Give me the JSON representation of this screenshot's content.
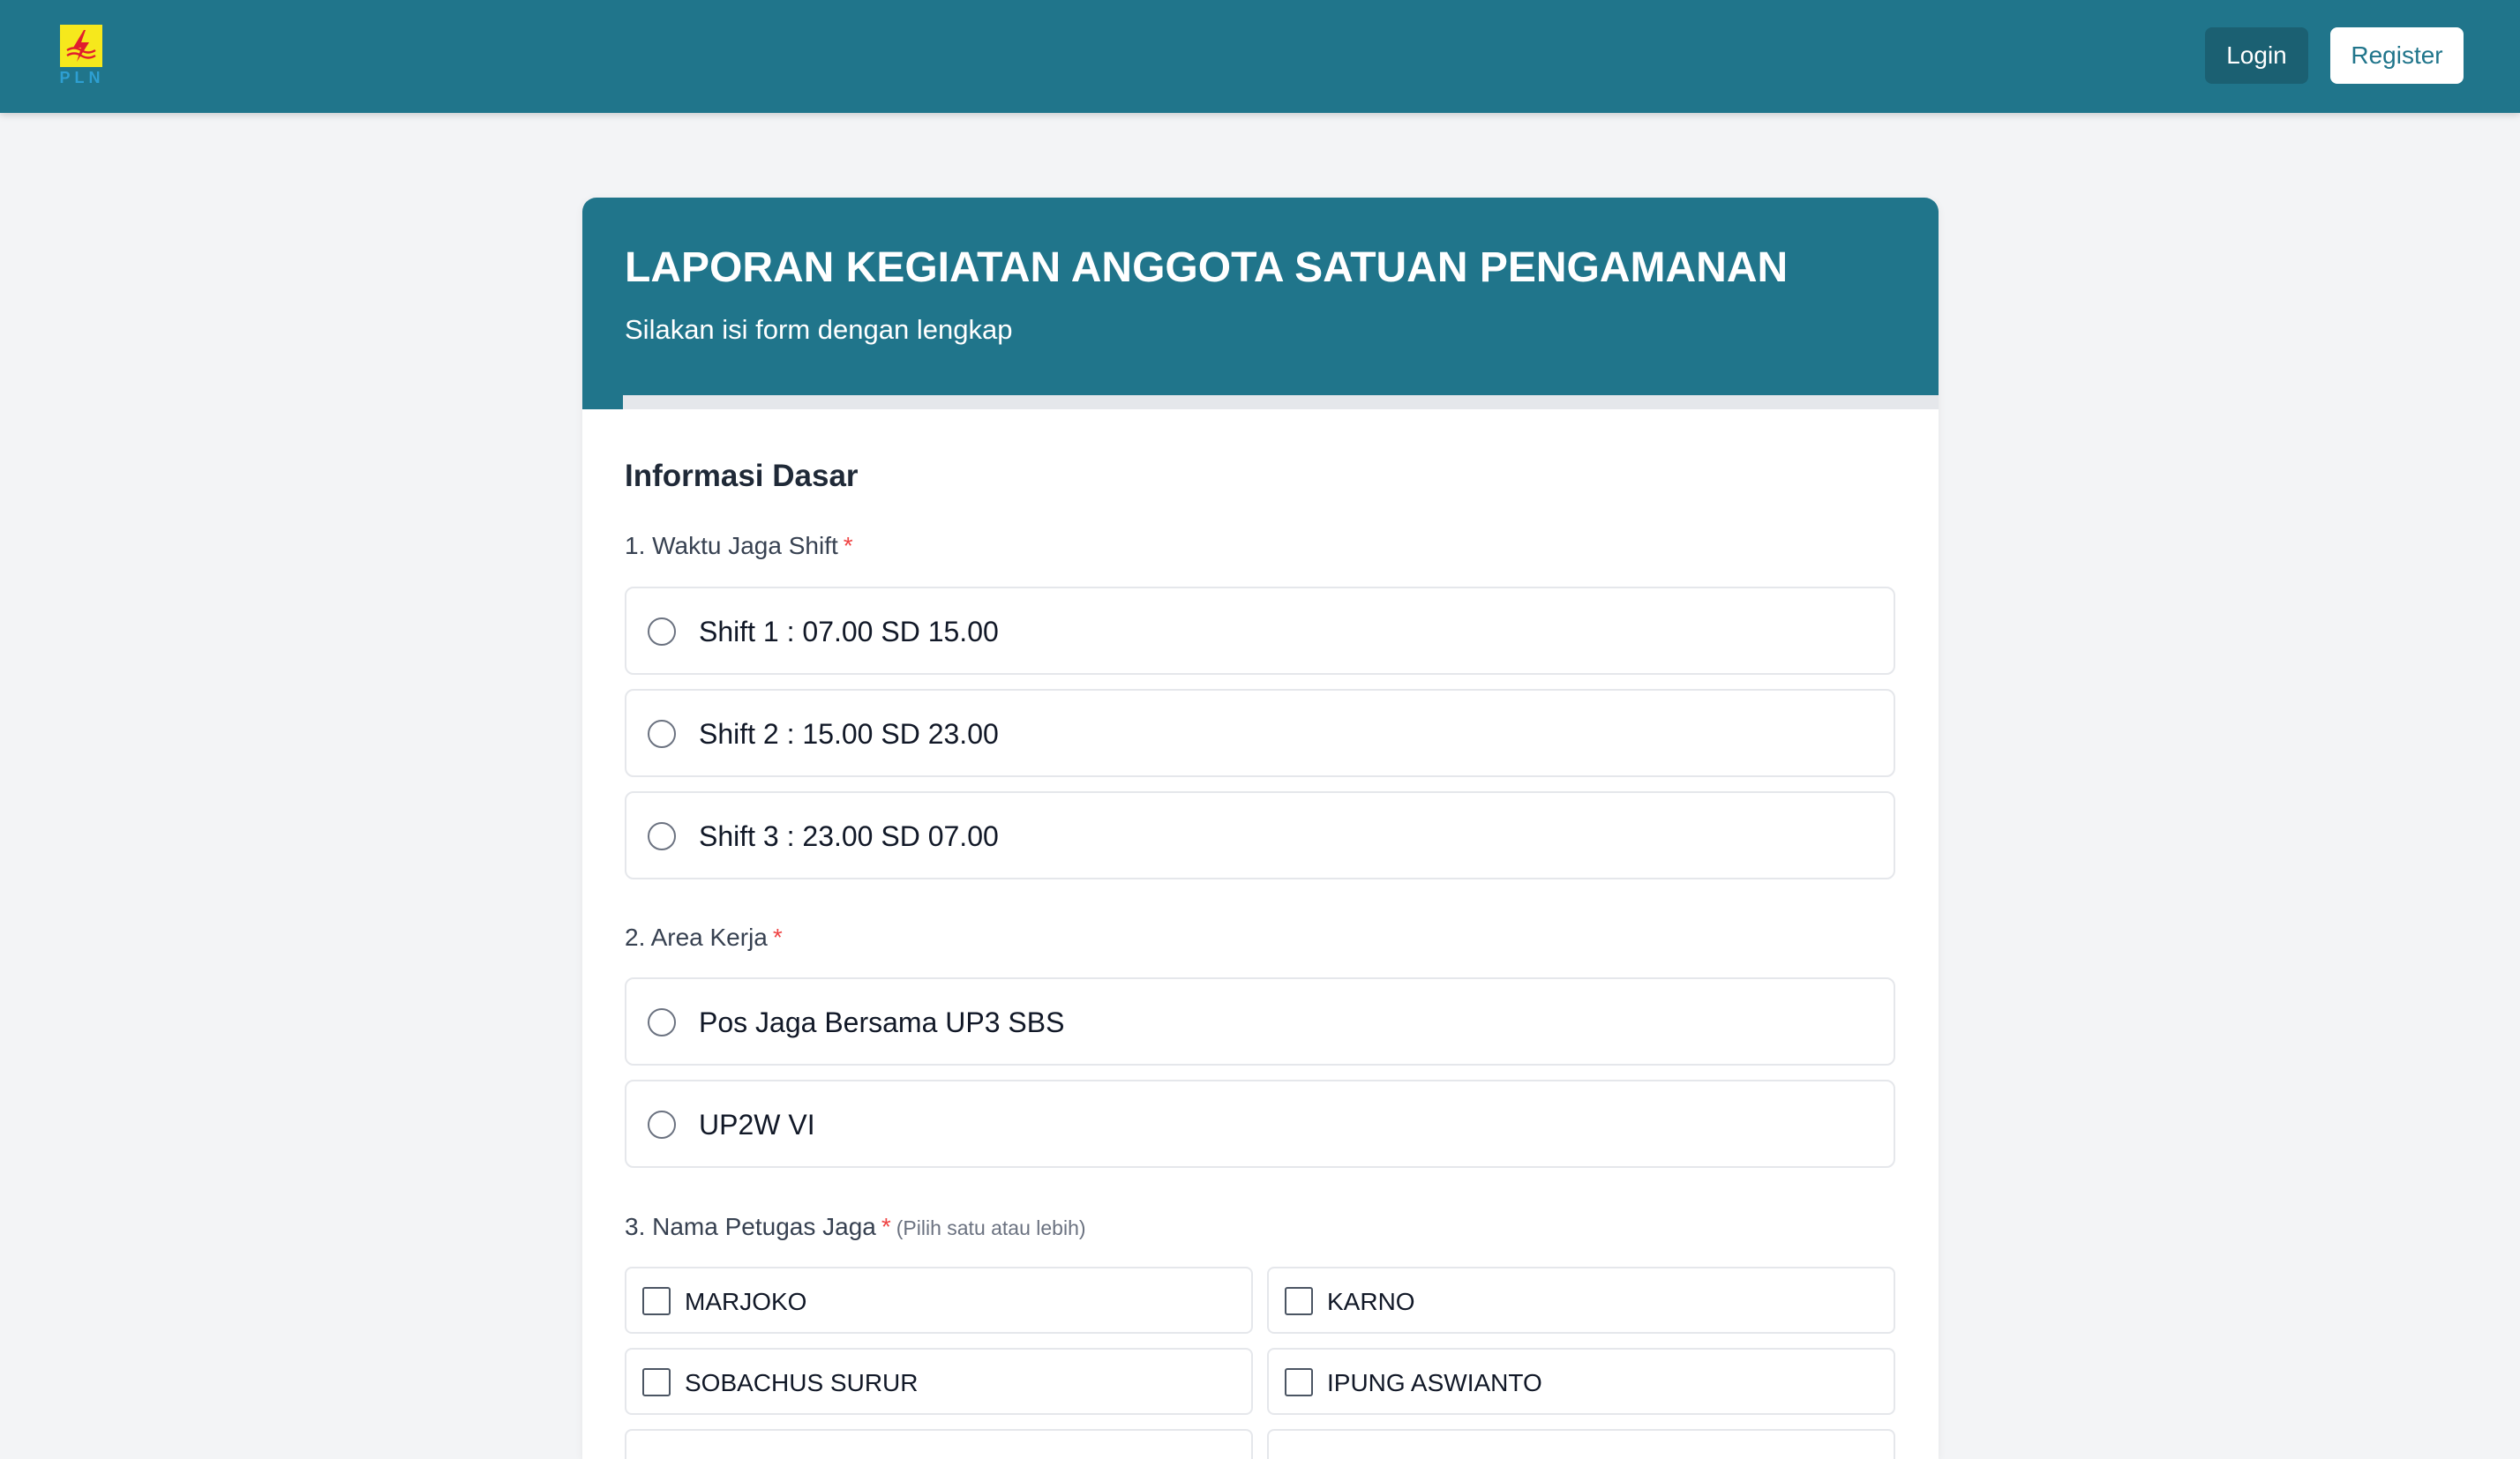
{
  "navbar": {
    "logo_text": "PLN",
    "login_label": "Login",
    "register_label": "Register"
  },
  "form": {
    "title": "LAPORAN KEGIATAN ANGGOTA SATUAN PENGAMANAN",
    "subtitle": "Silakan isi form dengan lengkap",
    "progress_percent": 3,
    "section_title": "Informasi Dasar",
    "required_mark": "*",
    "q1": {
      "label": "1. Waktu Jaga Shift",
      "options": [
        "Shift 1 : 07.00 SD 15.00",
        "Shift 2 : 15.00 SD 23.00",
        "Shift 3 : 23.00 SD 07.00"
      ]
    },
    "q2": {
      "label": "2. Area Kerja",
      "options": [
        "Pos Jaga Bersama UP3 SBS",
        "UP2W VI"
      ]
    },
    "q3": {
      "label": "3. Nama Petugas Jaga",
      "hint": "(Pilih satu atau lebih)",
      "options": [
        "MARJOKO",
        "KARNO",
        "SOBACHUS SURUR",
        "IPUNG ASWIANTO",
        "",
        ""
      ]
    }
  }
}
